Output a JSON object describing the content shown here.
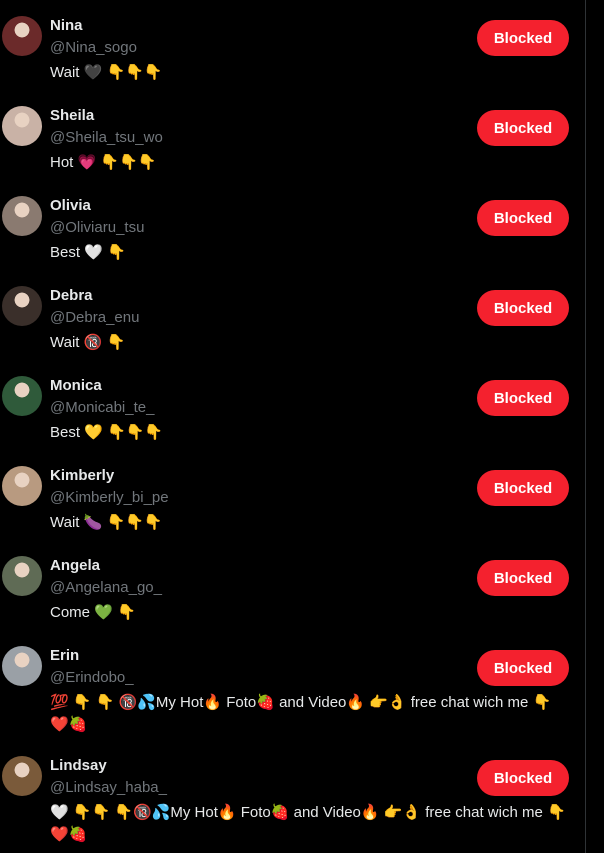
{
  "users": [
    {
      "name": "Nina",
      "handle": "@Nina_sogo",
      "bio": "Wait 🖤 👇👇👇",
      "button": "Blocked",
      "avatar_color": "#6b2a2a"
    },
    {
      "name": "Sheila",
      "handle": "@Sheila_tsu_wo",
      "bio": "Hot 💗 👇👇👇",
      "button": "Blocked",
      "avatar_color": "#c9b2a6"
    },
    {
      "name": "Olivia",
      "handle": "@Oliviaru_tsu",
      "bio": "Best 🤍 👇",
      "button": "Blocked",
      "avatar_color": "#8a7a70"
    },
    {
      "name": "Debra",
      "handle": "@Debra_enu",
      "bio": "Wait 🔞 👇",
      "button": "Blocked",
      "avatar_color": "#3a2f2a"
    },
    {
      "name": "Monica",
      "handle": "@Monicabi_te_",
      "bio": "Best 💛 👇👇👇",
      "button": "Blocked",
      "avatar_color": "#2f5a3a"
    },
    {
      "name": "Kimberly",
      "handle": "@Kimberly_bi_pe",
      "bio": "Wait 🍆 👇👇👇",
      "button": "Blocked",
      "avatar_color": "#b89a80"
    },
    {
      "name": "Angela",
      "handle": "@Angelana_go_",
      "bio": "Come 💚 👇",
      "button": "Blocked",
      "avatar_color": "#5f6b55"
    },
    {
      "name": "Erin",
      "handle": "@Erindobo_",
      "bio": "💯 👇 👇 🔞💦My Hot🔥 Foto🍓 and Video🔥 👉👌 free chat wich me 👇❤️🍓",
      "button": "Blocked",
      "avatar_color": "#9aa0a6"
    },
    {
      "name": "Lindsay",
      "handle": "@Lindsay_haba_",
      "bio": "🤍 👇👇 👇🔞💦My Hot🔥 Foto🍓 and Video🔥 👉👌 free chat wich me 👇❤️🍓",
      "button": "Blocked",
      "avatar_color": "#7a5a3a"
    }
  ]
}
